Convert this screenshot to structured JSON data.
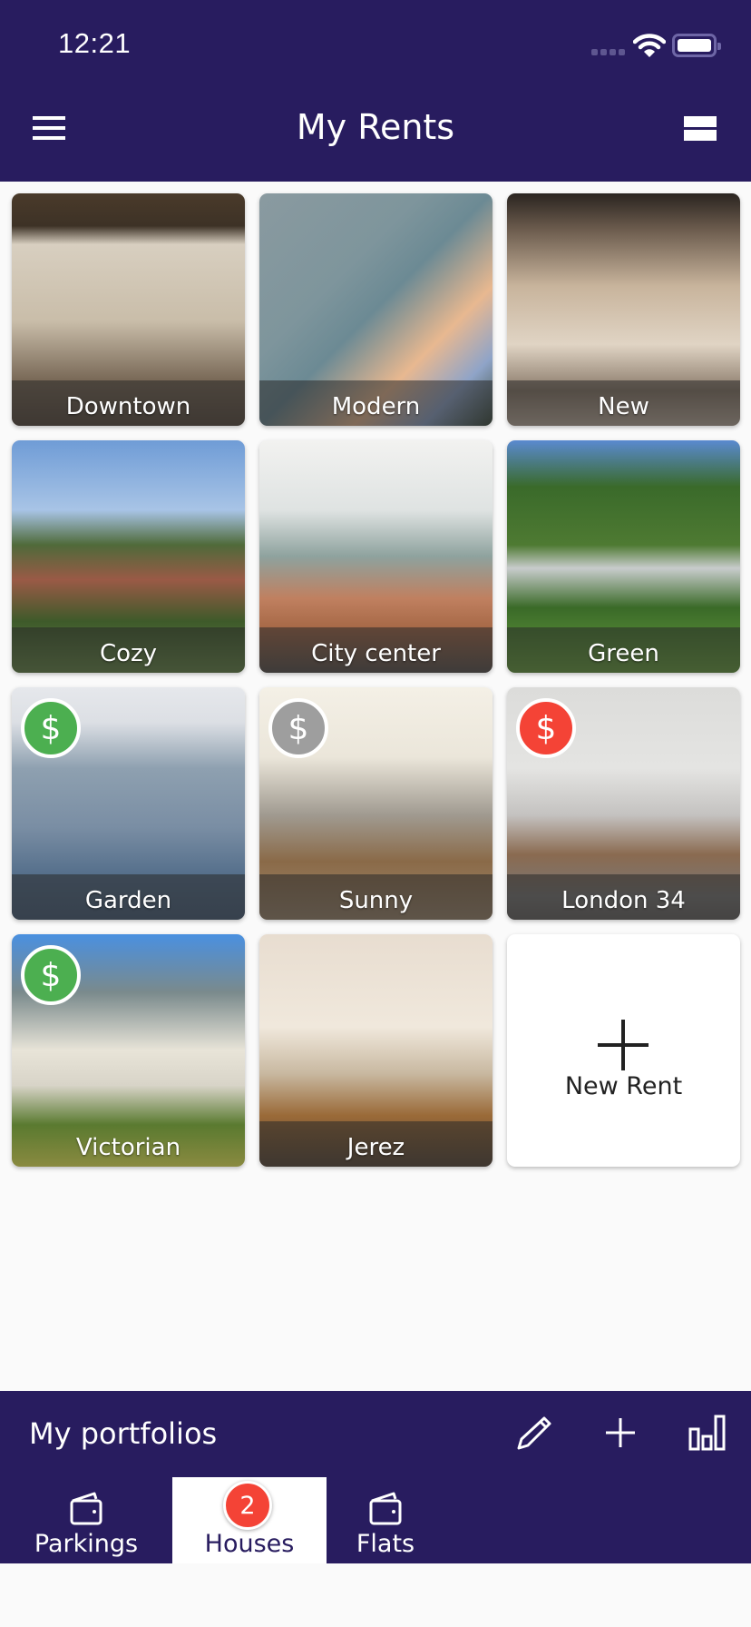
{
  "status_bar": {
    "time": "12:21"
  },
  "header": {
    "title": "My Rents",
    "menu_icon": "hamburger-menu-icon",
    "view_icon": "view-list-icon"
  },
  "colors": {
    "primary": "#281c5f",
    "badge_paid": "#4caf50",
    "badge_pending": "#9e9e9e",
    "badge_overdue": "#f44336",
    "background": "#fafafa"
  },
  "rents": [
    {
      "name": "Downtown",
      "payment_status": null
    },
    {
      "name": "Modern",
      "payment_status": null
    },
    {
      "name": "New",
      "payment_status": null
    },
    {
      "name": "Cozy",
      "payment_status": null
    },
    {
      "name": "City center",
      "payment_status": null
    },
    {
      "name": "Green",
      "payment_status": null
    },
    {
      "name": "Garden",
      "payment_status": "paid",
      "badge_symbol": "$"
    },
    {
      "name": "Sunny",
      "payment_status": "pending",
      "badge_symbol": "$"
    },
    {
      "name": "London 34",
      "payment_status": "overdue",
      "badge_symbol": "$"
    },
    {
      "name": "Victorian",
      "payment_status": "paid",
      "badge_symbol": "$"
    },
    {
      "name": "Jerez",
      "payment_status": null
    }
  ],
  "new_rent": {
    "label": "New Rent",
    "icon": "plus-icon"
  },
  "portfolios": {
    "title": "My portfolios",
    "actions": [
      "edit-icon",
      "add-icon",
      "stats-icon"
    ],
    "tabs": [
      {
        "label": "Parkings",
        "icon": "wallet-icon",
        "active": false
      },
      {
        "label": "Houses",
        "icon": "wallet-icon",
        "active": true,
        "badge": "2"
      },
      {
        "label": "Flats",
        "icon": "wallet-icon",
        "active": false
      }
    ]
  }
}
